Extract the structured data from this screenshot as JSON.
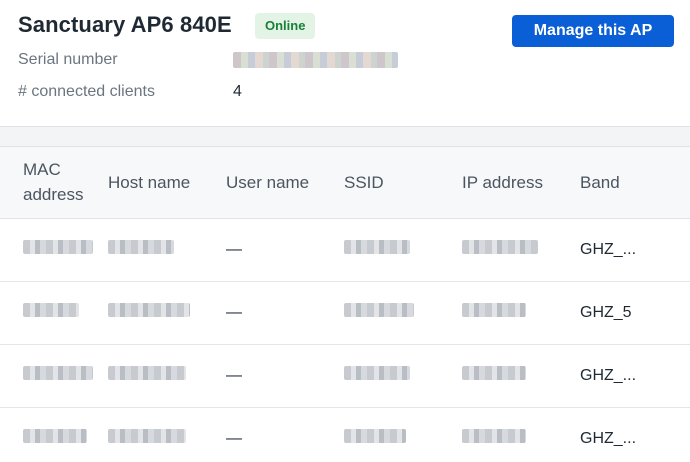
{
  "ap": {
    "name": "Sanctuary AP6 840E",
    "status": "Online",
    "status_color": "#1b7f37",
    "manage_label": "Manage this AP",
    "accent_color": "#0a5fd6"
  },
  "meta": {
    "serial_label": "Serial number",
    "serial_value_redacted": true,
    "clients_label": "# connected clients",
    "clients_value": "4"
  },
  "table": {
    "headers": {
      "mac": "MAC address",
      "host": "Host name",
      "user": "User name",
      "ssid": "SSID",
      "ip": "IP address",
      "band": "Band"
    },
    "rows": [
      {
        "user": "—",
        "band": "GHZ_..."
      },
      {
        "user": "—",
        "band": "GHZ_5"
      },
      {
        "user": "—",
        "band": "GHZ_..."
      },
      {
        "user": "—",
        "band": "GHZ_..."
      }
    ]
  }
}
